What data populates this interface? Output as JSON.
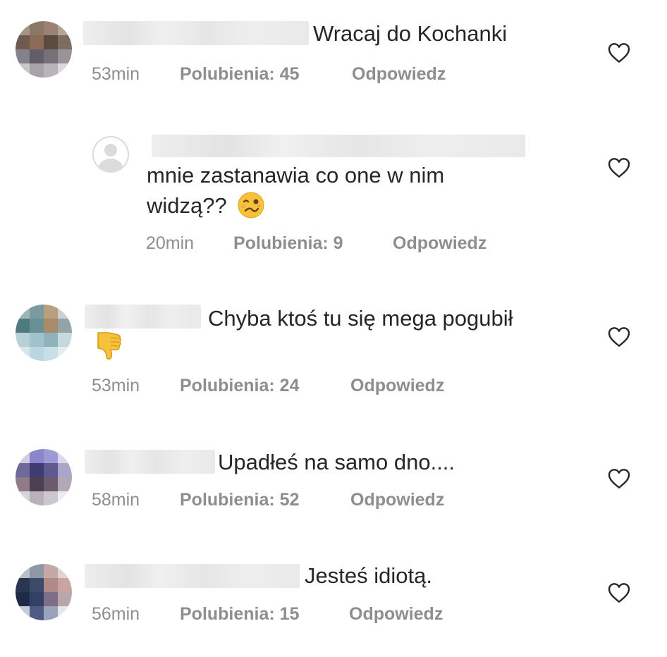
{
  "comments": [
    {
      "text": "Wracaj do Kochanki",
      "time": "53min",
      "likes": "Polubienia: 45",
      "reply": "Odpowiedz"
    },
    {
      "text_line1": "mnie zastanawia co one w nim",
      "text_line2": "widzą??",
      "emoji": "woozy-face",
      "time": "20min",
      "likes": "Polubienia: 9",
      "reply": "Odpowiedz"
    },
    {
      "text": "Chyba ktoś tu się mega pogubił",
      "emoji": "thumbs-down",
      "time": "53min",
      "likes": "Polubienia: 24",
      "reply": "Odpowiedz"
    },
    {
      "text": "Upadłeś na samo dno....",
      "time": "58min",
      "likes": "Polubienia: 52",
      "reply": "Odpowiedz"
    },
    {
      "text": "Jesteś idiotą.",
      "time": "56min",
      "likes": "Polubienia: 15",
      "reply": "Odpowiedz"
    }
  ],
  "icons": {
    "like": "heart-outline-icon"
  },
  "colors": {
    "text": "#262626",
    "meta": "#8e8e8e",
    "background": "#ffffff"
  }
}
